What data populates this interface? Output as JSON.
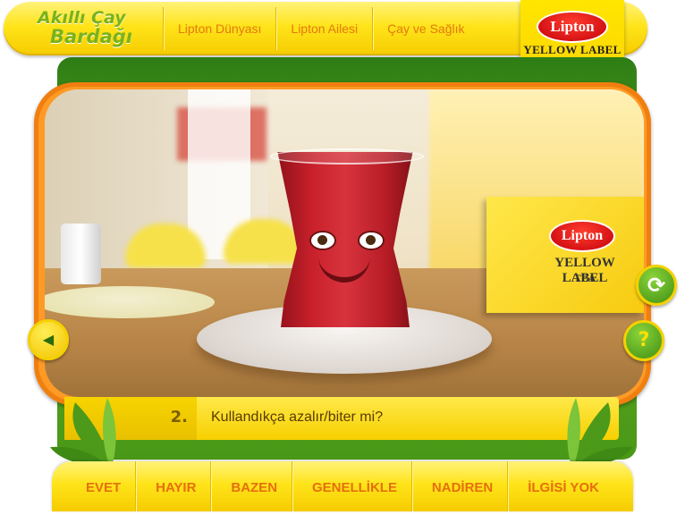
{
  "header": {
    "brand_line1": "Akıllı Çay",
    "brand_line2": "Bardağı",
    "nav": [
      "Lipton Dünyası",
      "Lipton Ailesi",
      "Çay ve Sağlık"
    ]
  },
  "logo": {
    "brand": "Lipton",
    "line1": "YELLOW LABEL",
    "line2": "TEA"
  },
  "question": {
    "number": "2.",
    "text": "Kullandıkça azalır/biter mi?"
  },
  "answers": [
    "EVET",
    "HAYIR",
    "BAZEN",
    "GENELLİKLE",
    "NADİREN",
    "İLGİSİ YOK"
  ],
  "icons": {
    "back": "left-arrow-icon",
    "refresh": "refresh-icon",
    "help": "question-mark-icon"
  },
  "colors": {
    "accent_orange": "#e56f0c",
    "brand_green": "#7ab21a",
    "lipton_yellow": "#ffe41a"
  }
}
